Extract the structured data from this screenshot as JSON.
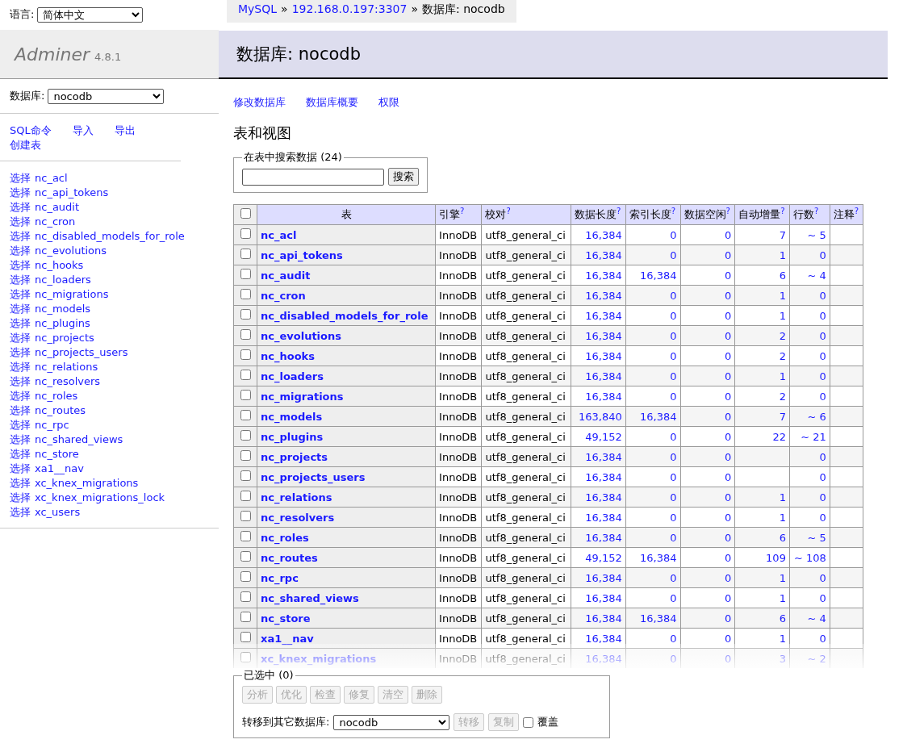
{
  "language": {
    "label": "语言:",
    "value": "简体中文"
  },
  "breadcrumb": [
    {
      "text": "MySQL",
      "kind": "link"
    },
    {
      "text": "»",
      "kind": "text"
    },
    {
      "text": "192.168.0.197:3307",
      "kind": "link"
    },
    {
      "text": "»",
      "kind": "text"
    },
    {
      "text": "数据库: nocodb",
      "kind": "text"
    }
  ],
  "logo": {
    "name": "Adminer",
    "version": "4.8.1"
  },
  "page_title": "数据库: nocodb",
  "sidebar": {
    "db_label": "数据库:",
    "db_value": "nocodb",
    "links": [
      "SQL命令",
      "导入",
      "导出",
      "创建表"
    ],
    "tables": [
      {
        "action": "选择",
        "name": "nc_acl"
      },
      {
        "action": "选择",
        "name": "nc_api_tokens"
      },
      {
        "action": "选择",
        "name": "nc_audit"
      },
      {
        "action": "选择",
        "name": "nc_cron"
      },
      {
        "action": "选择",
        "name": "nc_disabled_models_for_role"
      },
      {
        "action": "选择",
        "name": "nc_evolutions"
      },
      {
        "action": "选择",
        "name": "nc_hooks"
      },
      {
        "action": "选择",
        "name": "nc_loaders"
      },
      {
        "action": "选择",
        "name": "nc_migrations"
      },
      {
        "action": "选择",
        "name": "nc_models"
      },
      {
        "action": "选择",
        "name": "nc_plugins"
      },
      {
        "action": "选择",
        "name": "nc_projects"
      },
      {
        "action": "选择",
        "name": "nc_projects_users"
      },
      {
        "action": "选择",
        "name": "nc_relations"
      },
      {
        "action": "选择",
        "name": "nc_resolvers"
      },
      {
        "action": "选择",
        "name": "nc_roles"
      },
      {
        "action": "选择",
        "name": "nc_routes"
      },
      {
        "action": "选择",
        "name": "nc_rpc"
      },
      {
        "action": "选择",
        "name": "nc_shared_views"
      },
      {
        "action": "选择",
        "name": "nc_store"
      },
      {
        "action": "选择",
        "name": "xa1__nav"
      },
      {
        "action": "选择",
        "name": "xc_knex_migrations"
      },
      {
        "action": "选择",
        "name": "xc_knex_migrations_lock"
      },
      {
        "action": "选择",
        "name": "xc_users"
      }
    ]
  },
  "actions": [
    "修改数据库",
    "数据库概要",
    "权限"
  ],
  "section_title": "表和视图",
  "search": {
    "legend": "在表中搜索数据 (24)",
    "button": "搜索"
  },
  "table": {
    "all_checked": false,
    "columns": [
      {
        "label": "表"
      },
      {
        "label": "引擎",
        "help": "?"
      },
      {
        "label": "校对",
        "help": "?"
      },
      {
        "label": "数据长度",
        "help": "?"
      },
      {
        "label": "索引长度",
        "help": "?"
      },
      {
        "label": "数据空闲",
        "help": "?"
      },
      {
        "label": "自动增量",
        "help": "?"
      },
      {
        "label": "行数",
        "help": "?"
      },
      {
        "label": "注释",
        "help": "?"
      }
    ],
    "rows": [
      {
        "checked": false,
        "cells": [
          "nc_acl",
          "InnoDB",
          "utf8_general_ci",
          "16,384",
          "0",
          "0",
          "7",
          "~ 5",
          ""
        ]
      },
      {
        "checked": false,
        "cells": [
          "nc_api_tokens",
          "InnoDB",
          "utf8_general_ci",
          "16,384",
          "0",
          "0",
          "1",
          "0",
          ""
        ]
      },
      {
        "checked": false,
        "cells": [
          "nc_audit",
          "InnoDB",
          "utf8_general_ci",
          "16,384",
          "16,384",
          "0",
          "6",
          "~ 4",
          ""
        ]
      },
      {
        "checked": false,
        "cells": [
          "nc_cron",
          "InnoDB",
          "utf8_general_ci",
          "16,384",
          "0",
          "0",
          "1",
          "0",
          ""
        ]
      },
      {
        "checked": false,
        "cells": [
          "nc_disabled_models_for_role",
          "InnoDB",
          "utf8_general_ci",
          "16,384",
          "0",
          "0",
          "1",
          "0",
          ""
        ]
      },
      {
        "checked": false,
        "cells": [
          "nc_evolutions",
          "InnoDB",
          "utf8_general_ci",
          "16,384",
          "0",
          "0",
          "2",
          "0",
          ""
        ]
      },
      {
        "checked": false,
        "cells": [
          "nc_hooks",
          "InnoDB",
          "utf8_general_ci",
          "16,384",
          "0",
          "0",
          "2",
          "0",
          ""
        ]
      },
      {
        "checked": false,
        "cells": [
          "nc_loaders",
          "InnoDB",
          "utf8_general_ci",
          "16,384",
          "0",
          "0",
          "1",
          "0",
          ""
        ]
      },
      {
        "checked": false,
        "cells": [
          "nc_migrations",
          "InnoDB",
          "utf8_general_ci",
          "16,384",
          "0",
          "0",
          "2",
          "0",
          ""
        ]
      },
      {
        "checked": false,
        "cells": [
          "nc_models",
          "InnoDB",
          "utf8_general_ci",
          "163,840",
          "16,384",
          "0",
          "7",
          "~ 6",
          ""
        ]
      },
      {
        "checked": false,
        "cells": [
          "nc_plugins",
          "InnoDB",
          "utf8_general_ci",
          "49,152",
          "0",
          "0",
          "22",
          "~ 21",
          ""
        ]
      },
      {
        "checked": false,
        "cells": [
          "nc_projects",
          "InnoDB",
          "utf8_general_ci",
          "16,384",
          "0",
          "0",
          "",
          "0",
          ""
        ]
      },
      {
        "checked": false,
        "cells": [
          "nc_projects_users",
          "InnoDB",
          "utf8_general_ci",
          "16,384",
          "0",
          "0",
          "",
          "0",
          ""
        ]
      },
      {
        "checked": false,
        "cells": [
          "nc_relations",
          "InnoDB",
          "utf8_general_ci",
          "16,384",
          "0",
          "0",
          "1",
          "0",
          ""
        ]
      },
      {
        "checked": false,
        "cells": [
          "nc_resolvers",
          "InnoDB",
          "utf8_general_ci",
          "16,384",
          "0",
          "0",
          "1",
          "0",
          ""
        ]
      },
      {
        "checked": false,
        "cells": [
          "nc_roles",
          "InnoDB",
          "utf8_general_ci",
          "16,384",
          "0",
          "0",
          "6",
          "~ 5",
          ""
        ]
      },
      {
        "checked": false,
        "cells": [
          "nc_routes",
          "InnoDB",
          "utf8_general_ci",
          "49,152",
          "16,384",
          "0",
          "109",
          "~ 108",
          ""
        ]
      },
      {
        "checked": false,
        "cells": [
          "nc_rpc",
          "InnoDB",
          "utf8_general_ci",
          "16,384",
          "0",
          "0",
          "1",
          "0",
          ""
        ]
      },
      {
        "checked": false,
        "cells": [
          "nc_shared_views",
          "InnoDB",
          "utf8_general_ci",
          "16,384",
          "0",
          "0",
          "1",
          "0",
          ""
        ]
      },
      {
        "checked": false,
        "cells": [
          "nc_store",
          "InnoDB",
          "utf8_general_ci",
          "16,384",
          "16,384",
          "0",
          "6",
          "~ 4",
          ""
        ]
      },
      {
        "checked": false,
        "cells": [
          "xa1__nav",
          "InnoDB",
          "utf8_general_ci",
          "16,384",
          "0",
          "0",
          "1",
          "0",
          ""
        ]
      },
      {
        "checked": false,
        "cells": [
          "xc_knex_migrations",
          "InnoDB",
          "utf8_general_ci",
          "16,384",
          "0",
          "0",
          "3",
          "~ 2",
          ""
        ]
      }
    ]
  },
  "selection": {
    "legend": "已选中 (0)",
    "buttons": [
      "分析",
      "优化",
      "检查",
      "修复",
      "清空",
      "删除"
    ],
    "move_label": "转移到其它数据库:",
    "move_value": "nocodb",
    "move_buttons": [
      "转移",
      "复制"
    ],
    "overwrite": {
      "label": "覆盖",
      "checked": false
    }
  }
}
